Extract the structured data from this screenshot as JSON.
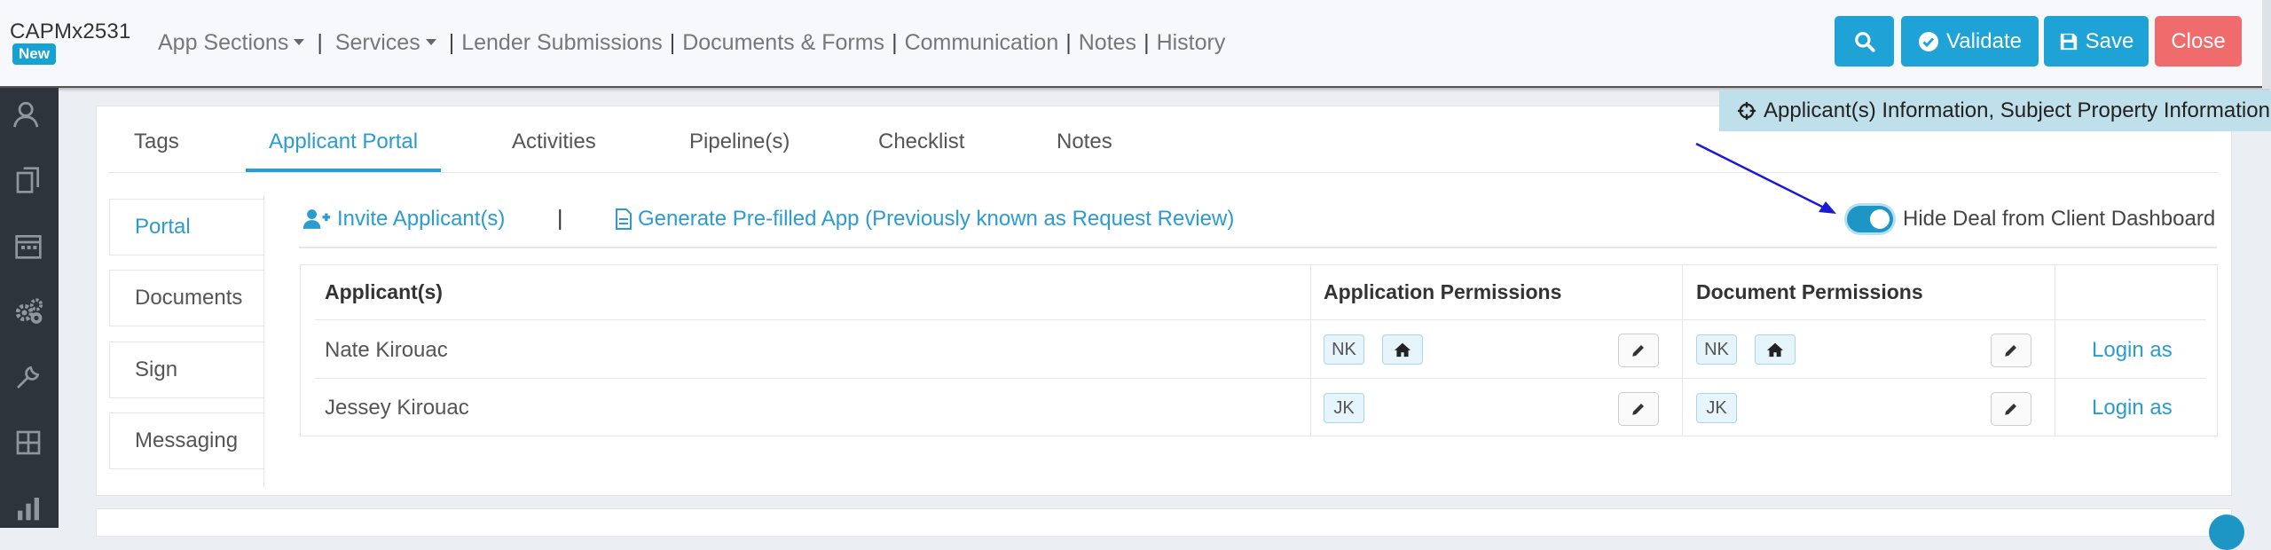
{
  "header": {
    "app_id": "CAPMx2531",
    "status_badge": "New",
    "nav": [
      {
        "label": "App Sections",
        "dropdown": true
      },
      {
        "label": "Services",
        "dropdown": true
      },
      {
        "label": "Lender Submissions"
      },
      {
        "label": "Documents & Forms"
      },
      {
        "label": "Communication"
      },
      {
        "label": "Notes"
      },
      {
        "label": "History"
      }
    ],
    "buttons": {
      "search_icon": "search-icon",
      "validate": "Validate",
      "save": "Save",
      "close": "Close"
    }
  },
  "banner": {
    "text": "Applicant(s) Information, Subject Property Information"
  },
  "tabs": [
    "Tags",
    "Applicant Portal",
    "Activities",
    "Pipeline(s)",
    "Checklist",
    "Notes"
  ],
  "active_tab": "Applicant Portal",
  "side_tabs": [
    "Portal",
    "Documents",
    "Sign",
    "Messaging"
  ],
  "active_side_tab": "Portal",
  "actions": {
    "invite": "Invite Applicant(s)",
    "separator": "|",
    "generate": "Generate Pre-filled App (Previously known as Request Review)"
  },
  "toggle": {
    "label": "Hide Deal from Client Dashboard",
    "on": true
  },
  "table": {
    "headers": [
      "Applicant(s)",
      "Application Permissions",
      "Document Permissions",
      ""
    ],
    "rows": [
      {
        "name": "Nate Kirouac",
        "app_perm": [
          "NK",
          "home-icon"
        ],
        "doc_perm": [
          "NK",
          "home-icon"
        ],
        "action": "Login as"
      },
      {
        "name": "Jessey Kirouac",
        "app_perm": [
          "JK"
        ],
        "doc_perm": [
          "JK"
        ],
        "action": "Login as"
      }
    ]
  },
  "colors": {
    "accent": "#2b9bd1",
    "primary_button": "#1fa2d6",
    "danger_button": "#f06b6b",
    "sidebar": "#2d343c",
    "annotation_arrow": "#1a1ad6"
  }
}
